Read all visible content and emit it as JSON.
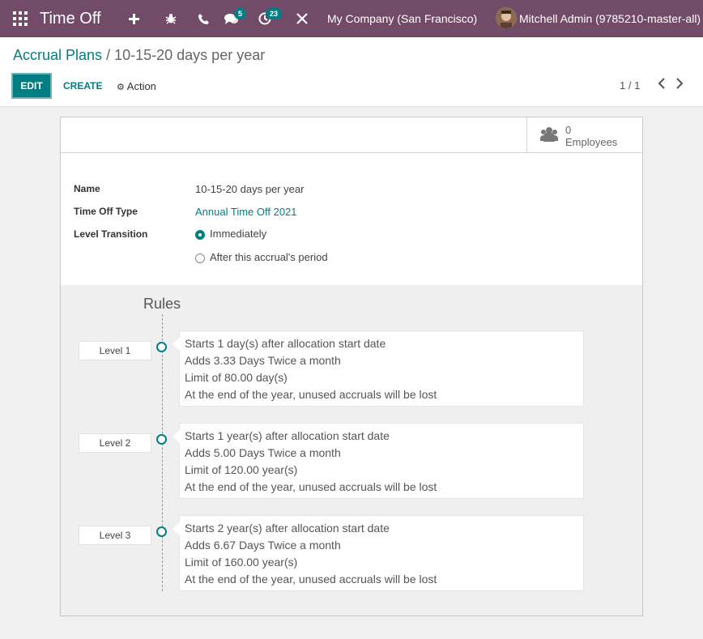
{
  "navbar": {
    "app_name": "Time Off",
    "chat_badge": "5",
    "activity_badge": "23",
    "company": "My Company (San Francisco)",
    "user": "Mitchell Admin (9785210-master-all)"
  },
  "breadcrumb": {
    "parent": "Accrual Plans",
    "separator": "/",
    "current": "10-15-20 days per year"
  },
  "toolbar": {
    "edit_label": "EDIT",
    "create_label": "CREATE",
    "action_label": "Action"
  },
  "pager": {
    "value": "1 / 1"
  },
  "stat": {
    "value": "0",
    "label": "Employees"
  },
  "form": {
    "name_label": "Name",
    "name_value": "10-15-20 days per year",
    "type_label": "Time Off Type",
    "type_value": "Annual Time Off 2021",
    "transition_label": "Level Transition",
    "transition_options": [
      "Immediately",
      "After this accrual's period"
    ],
    "transition_selected": "Immediately"
  },
  "rules": {
    "title": "Rules",
    "levels": [
      {
        "label": "Level 1",
        "lines": [
          "Starts 1 day(s) after allocation start date",
          "Adds 3.33 Days Twice a month",
          "Limit of 80.00 day(s)",
          "At the end of the year, unused accruals will be lost"
        ]
      },
      {
        "label": "Level 2",
        "lines": [
          "Starts 1 year(s) after allocation start date",
          "Adds 5.00 Days Twice a month",
          "Limit of 120.00 year(s)",
          "At the end of the year, unused accruals will be lost"
        ]
      },
      {
        "label": "Level 3",
        "lines": [
          "Starts 2 year(s) after allocation start date",
          "Adds 6.67 Days Twice a month",
          "Limit of 160.00 year(s)",
          "At the end of the year, unused accruals will be lost"
        ]
      }
    ]
  },
  "colors": {
    "navbar": "#714b67",
    "accent": "#017e84"
  },
  "icons": [
    "apps-grid-icon",
    "plus-icon",
    "bug-icon",
    "phone-icon",
    "chat-icon",
    "activity-icon",
    "tools-icon",
    "gear-icon",
    "chevron-left-icon",
    "chevron-right-icon",
    "users-icon"
  ]
}
